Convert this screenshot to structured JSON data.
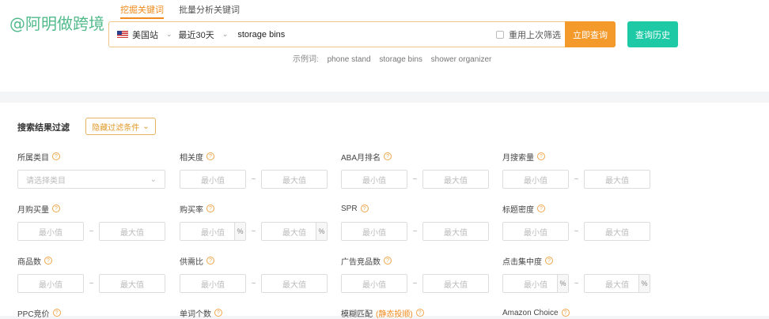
{
  "watermark": "@阿明做跨境",
  "tabs": [
    "挖掘关键词",
    "批量分析关键词"
  ],
  "search": {
    "site": "美国站",
    "period": "最近30天",
    "query": "storage bins",
    "reuse_label": "重用上次筛选",
    "submit_label": "立即查询",
    "history_label": "查询历史"
  },
  "examples": {
    "label": "示例词:",
    "items": [
      "phone stand",
      "storage bins",
      "shower organizer"
    ]
  },
  "filter": {
    "title": "搜索结果过滤",
    "toggle_label": "隐藏过滤条件",
    "min": "最小值",
    "max": "最大值",
    "percent": "%",
    "tilde": "~",
    "fields": {
      "category": {
        "label": "所属类目",
        "placeholder": "请选择类目"
      },
      "relevance": {
        "label": "相关度"
      },
      "aba": {
        "label": "ABA月排名"
      },
      "monthly_search": {
        "label": "月搜索量"
      },
      "monthly_purchase": {
        "label": "月购买量"
      },
      "purchase_rate": {
        "label": "购买率"
      },
      "spr": {
        "label": "SPR"
      },
      "title_density": {
        "label": "标题密度"
      },
      "product_count": {
        "label": "商品数"
      },
      "supply_demand": {
        "label": "供需比"
      },
      "ad_product_count": {
        "label": "广告竞品数"
      },
      "click_concentration": {
        "label": "点击集中度"
      },
      "ppc_bid": {
        "label": "PPC竞价"
      },
      "word_count": {
        "label": "单词个数"
      },
      "fuzzy_match": {
        "label": "模糊匹配",
        "hot": "(静态投顺)"
      },
      "amazon_choice": {
        "label": "Amazon Choice"
      }
    }
  }
}
